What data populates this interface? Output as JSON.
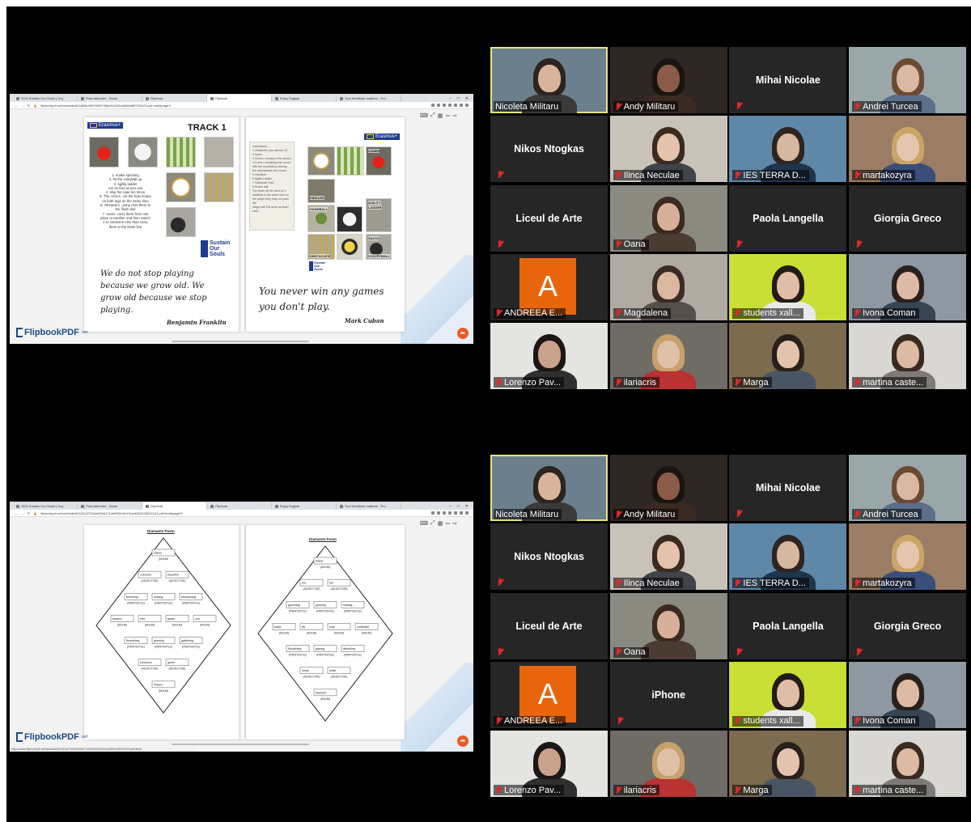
{
  "screens": [
    {
      "browser": {
        "tabs": [
          "SOS-Sustain Our Souls | Org",
          "Post-Attendee - Zoom",
          "Flipbook",
          "Flipbook",
          "Enjoy English",
          "Your feedback matters! - Pro"
        ],
        "url": "flipbookpdf.net/web/site/8c0d55b49f29f399786e9b1e50c8460a89f72f3103.pdf.html#page/1"
      },
      "flipbook": {
        "erasmus": "Erasmus+",
        "track_title": "TRACK 1",
        "steps": [
          "1.        snake spinning",
          "2.        hit the voleyball up",
          "3.        agility ladder",
          "run as fast as you can",
          "4. skip the rope ten times",
          "5. The circles - do the hula hoops",
          "on both legs on the same time",
          "6. Obstacles - jump over them to",
          "the finish line",
          "7. sacks- carry them from one",
          "place to another and then switch",
          "it to someone else than carry",
          "them to the finish line"
        ],
        "sos_logo": [
          "Sustain",
          "Our",
          "Souls"
        ],
        "quote_left": "We do not stop playing because we grow old. We grow old because we stop playing.",
        "quote_left_author": "Benjamin Franklin",
        "quote_right": "You never win any games you don't play.",
        "quote_right_author": "Mark Cuban",
        "card_lines": [
          "Instructions:",
          "1 Obstacles: you will see 10",
          "2 sacks",
          "3 Circles: running in the circles",
          "4 Cones: combining the cones",
          "with the handball by kicking",
          "the ball between the cones",
          "5 Handball",
          "6 Agility Ladder",
          "7 Volleyball: Kick",
          "8 Snake ball",
          "The team will be done by 2",
          "students in the same time so",
          "the player they may not pass the",
          "stage until it is done as team color"
        ],
        "station_labels": [
          "CONES",
          "CIRCLES",
          "HANDBALL",
          "OBSTACLES",
          "SACKS",
          "VOLLEYBALL",
          "AGILITY",
          "LADDER"
        ],
        "brand": "FlipbookPDF",
        "brand_suffix": ".net"
      }
    },
    {
      "browser": {
        "tabs": [
          "SOS-Sustain Our Souls | Org",
          "Post-Attendee - Zoom",
          "Flipbook",
          "Flipbook",
          "Enjoy English",
          "Your feedback matters! - Pro"
        ],
        "url": "flipbookpdf.net/web/site/6012f1d2702ae5346171de5352c0b231ad082f108202103.pdf.html#page/9",
        "status_url": "https://www.flipbookpdf.net/web/site/6012f1d2702ae5346171de5352c0b231ad082f108202103.pdf.html#"
      },
      "flipbook": {
        "left_title": "Diamante Poem",
        "right_title": "Diamante Poem",
        "left_rows": [
          {
            "words": [
              "nature"
            ],
            "tags": [
              "(NOUN)"
            ]
          },
          {
            "words": [
              "colourful",
              "beautiful"
            ],
            "tags": [
              "(ADJECTIVE)",
              "(ADJECTIVE)"
            ]
          },
          {
            "words": [
              "blooming",
              "shining",
              "blossoming"
            ],
            "tags": [
              "(PARTICIPLE)",
              "(PARTICIPLE)",
              "(PARTICIPLE)"
            ]
          },
          {
            "words": [
              "flowers",
              "tree",
              "grass",
              "sun"
            ],
            "tags": [
              "(NOUN)",
              "(NOUN)",
              "(NOUN)",
              "(NOUN)"
            ]
          },
          {
            "words": [
              "flourishing",
              "growing",
              "gathering"
            ],
            "tags": [
              "(PARTICIPLE)",
              "(PARTICIPLE)",
              "(PARTICIPLE)"
            ]
          },
          {
            "words": [
              "luminous",
              "green"
            ],
            "tags": [
              "(ADJECTIVE)",
              "(ADJECTIVE)"
            ]
          },
          {
            "words": [
              "flowers"
            ],
            "tags": [
              "(NOUN)"
            ]
          }
        ],
        "right_rows": [
          {
            "words": [
              "flower"
            ],
            "tags": [
              "(NOUN)"
            ]
          },
          {
            "words": [
              "red",
              "tall"
            ],
            "tags": [
              "(ADJECTIVE)",
              "(ADJECTIVE)"
            ]
          },
          {
            "words": [
              "glooming",
              "growing",
              "shining"
            ],
            "tags": [
              "(PARTICIPLE)",
              "(PARTICIPLE)",
              "(PARTICIPLE)"
            ]
          },
          {
            "words": [
              "tulips",
              "lily",
              "rose",
              "sunflower"
            ],
            "tags": [
              "(NOUN)",
              "(NOUN)",
              "(NOUN)",
              "(NOUN)"
            ]
          },
          {
            "words": [
              "flourishing",
              "glaring",
              "attracting"
            ],
            "tags": [
              "(PARTICIPLE)",
              "(PARTICIPLE)",
              "(PARTICIPLE)"
            ]
          },
          {
            "words": [
              "small",
              "white"
            ],
            "tags": [
              "(ADJECTIVE)",
              "(ADJECTIVE)"
            ]
          },
          {
            "words": [
              "blossom"
            ],
            "tags": [
              "(NOUN)"
            ]
          }
        ],
        "brand": "FlipbookPDF",
        "brand_suffix": ".net"
      }
    }
  ],
  "zoom_grids": [
    {
      "participants": [
        {
          "name": "Nicoleta Militaru",
          "video": true,
          "muted": false,
          "active": true
        },
        {
          "name": "Andy Militaru",
          "video": true,
          "muted": true
        },
        {
          "name": "Mihai Nicolae",
          "video": false,
          "muted": true
        },
        {
          "name": "Andrei Turcea",
          "video": true,
          "muted": true
        },
        {
          "name": "Nikos Ntogkas",
          "video": false,
          "muted": true
        },
        {
          "name": "Ilinca Neculae",
          "video": true,
          "muted": true
        },
        {
          "name": "IES TERRA D...",
          "video": true,
          "muted": true
        },
        {
          "name": "martakozyra",
          "video": true,
          "muted": true
        },
        {
          "name": "Liceul de Arte",
          "video": false,
          "muted": true
        },
        {
          "name": "Oana",
          "video": true,
          "muted": true
        },
        {
          "name": "Paola Langella",
          "video": false,
          "muted": true
        },
        {
          "name": "Giorgia Greco",
          "video": false,
          "muted": true
        },
        {
          "name": "ANDREEA E...",
          "video": false,
          "avatar": "A",
          "muted": true
        },
        {
          "name": "Magdalena",
          "video": true,
          "muted": true
        },
        {
          "name": "students xall...",
          "video": true,
          "muted": true
        },
        {
          "name": "Ivona Coman",
          "video": true,
          "muted": true
        },
        {
          "name": "Lorenzo Pav...",
          "video": true,
          "muted": true
        },
        {
          "name": "ilariacris",
          "video": true,
          "muted": true
        },
        {
          "name": "Marga",
          "video": true,
          "muted": true
        },
        {
          "name": "martina caste...",
          "video": true,
          "muted": true
        }
      ]
    },
    {
      "participants": [
        {
          "name": "Nicoleta Militaru",
          "video": true,
          "muted": false,
          "active": true
        },
        {
          "name": "Andy Militaru",
          "video": true,
          "muted": true
        },
        {
          "name": "Mihai Nicolae",
          "video": false,
          "muted": true
        },
        {
          "name": "Andrei Turcea",
          "video": true,
          "muted": true
        },
        {
          "name": "Nikos Ntogkas",
          "video": false,
          "muted": true
        },
        {
          "name": "Ilinca Neculae",
          "video": true,
          "muted": true
        },
        {
          "name": "IES TERRA D...",
          "video": true,
          "muted": true
        },
        {
          "name": "martakozyra",
          "video": true,
          "muted": true
        },
        {
          "name": "Liceul de Arte",
          "video": false,
          "muted": true
        },
        {
          "name": "Oana",
          "video": true,
          "muted": true
        },
        {
          "name": "Paola Langella",
          "video": false,
          "muted": true
        },
        {
          "name": "Giorgia Greco",
          "video": false,
          "muted": true
        },
        {
          "name": "ANDREEA E...",
          "video": false,
          "avatar": "A",
          "muted": true
        },
        {
          "name": "iPhone",
          "video": false,
          "muted": true
        },
        {
          "name": "students xall...",
          "video": true,
          "muted": true
        },
        {
          "name": "Ivona Coman",
          "video": true,
          "muted": true
        },
        {
          "name": "Lorenzo Pav...",
          "video": true,
          "muted": true
        },
        {
          "name": "ilariacris",
          "video": true,
          "muted": true
        },
        {
          "name": "Marga",
          "video": true,
          "muted": true
        },
        {
          "name": "martina caste...",
          "video": true,
          "muted": true
        }
      ]
    }
  ],
  "colors": {
    "active_speaker": "#e8e37a",
    "muted_icon": "#e02828",
    "avatar": "#e8650d",
    "tile_bg": "#262626"
  }
}
